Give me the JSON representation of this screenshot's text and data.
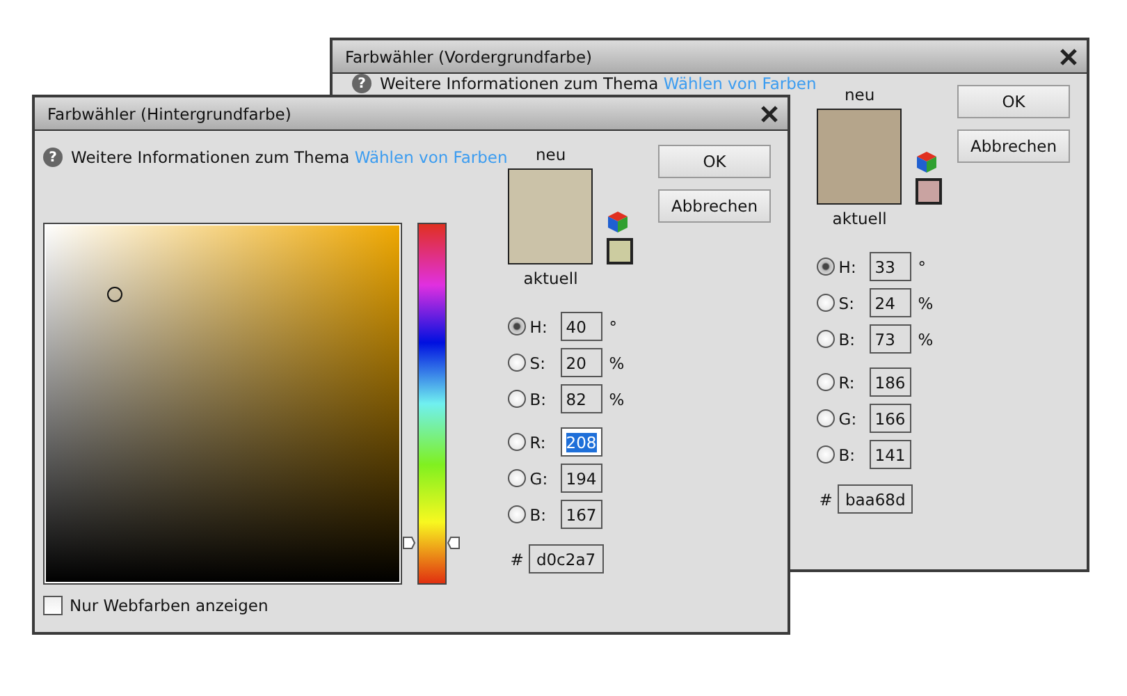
{
  "dialogs": [
    {
      "title": "Farbwähler (Vordergrundfarbe)",
      "help_icon": "?",
      "help_text": "Weitere Informationen zum Thema ",
      "help_link": "Wählen von Farben",
      "new_label": "neu",
      "current_label": "aktuell",
      "buttons": [
        "OK",
        "Abbrechen"
      ],
      "fields": [
        {
          "label": "H:",
          "value": "33",
          "unit": "°",
          "selected": true,
          "highlighted": false
        },
        {
          "label": "S:",
          "value": "24",
          "unit": "%",
          "selected": false,
          "highlighted": false
        },
        {
          "label": "B:",
          "value": "73",
          "unit": "%",
          "selected": false,
          "highlighted": false
        },
        {
          "label": "R:",
          "value": "186",
          "selected": false,
          "highlighted": false
        },
        {
          "label": "G:",
          "value": "166",
          "selected": false,
          "highlighted": false
        },
        {
          "label": "B:",
          "value": "141",
          "selected": false,
          "highlighted": false
        }
      ],
      "hex_label": "#",
      "hex": "baa68d"
    },
    {
      "title": "Farbwähler (Hintergrundfarbe)",
      "help_icon": "?",
      "help_text": "Weitere Informationen zum Thema ",
      "help_link": "Wählen von Farben",
      "new_label": "neu",
      "current_label": "aktuell",
      "buttons": [
        "OK",
        "Abbrechen"
      ],
      "fields": [
        {
          "label": "H:",
          "value": "40",
          "unit": "°",
          "selected": true,
          "highlighted": false
        },
        {
          "label": "S:",
          "value": "20",
          "unit": "%",
          "selected": false,
          "highlighted": false
        },
        {
          "label": "B:",
          "value": "82",
          "unit": "%",
          "selected": false,
          "highlighted": false
        },
        {
          "label": "R:",
          "value": "208",
          "selected": false,
          "highlighted": true
        },
        {
          "label": "G:",
          "value": "194",
          "selected": false,
          "highlighted": false
        },
        {
          "label": "B:",
          "value": "167",
          "selected": false,
          "highlighted": false
        }
      ],
      "hex_label": "#",
      "hex": "d0c2a7",
      "picker": {
        "hue_slider": {
          "level": 0.115
        },
        "webcolors": {
          "label": "Nur Webfarben anzeigen",
          "checked": false
        }
      }
    }
  ]
}
